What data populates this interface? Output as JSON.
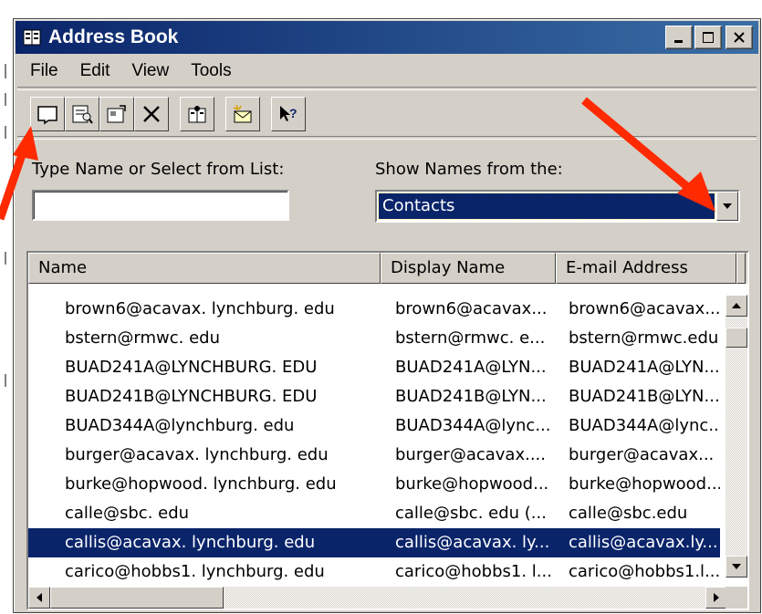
{
  "window": {
    "title": "Address Book"
  },
  "menu": [
    "File",
    "Edit",
    "View",
    "Tools"
  ],
  "toolbar": {
    "buttons": [
      "new-contact",
      "properties-card",
      "properties",
      "delete",
      "find",
      "new-message",
      "help"
    ]
  },
  "search": {
    "label": "Type Name or Select from List:",
    "value": ""
  },
  "source": {
    "label": "Show Names from the:",
    "selected": "Contacts"
  },
  "list": {
    "columns": [
      "Name",
      "Display Name",
      "E-mail Address"
    ],
    "rows": [
      {
        "name": "brown6@acavax. lynchburg. edu",
        "display": "brown6@acavax...",
        "email": "brown6@acavax..."
      },
      {
        "name": "bstern@rmwc. edu",
        "display": "bstern@rmwc. e...",
        "email": "bstern@rmwc.edu"
      },
      {
        "name": "BUAD241A@LYNCHBURG. EDU",
        "display": "BUAD241A@LYN...",
        "email": "BUAD241A@LYN..."
      },
      {
        "name": "BUAD241B@LYNCHBURG. EDU",
        "display": "BUAD241B@LYN...",
        "email": "BUAD241B@LYN..."
      },
      {
        "name": "BUAD344A@lynchburg. edu",
        "display": "BUAD344A@lync...",
        "email": "BUAD344A@lync..."
      },
      {
        "name": "burger@acavax. lynchburg. edu",
        "display": "burger@acavax....",
        "email": "burger@acavax..."
      },
      {
        "name": "burke@hopwood. lynchburg. edu",
        "display": "burke@hopwood...",
        "email": "burke@hopwood..."
      },
      {
        "name": "calle@sbc. edu",
        "display": "calle@sbc. edu (...",
        "email": "calle@sbc.edu"
      },
      {
        "name": "callis@acavax. lynchburg. edu",
        "display": "callis@acavax. ly...",
        "email": "callis@acavax.ly..."
      },
      {
        "name": "carico@hobbs1. lynchburg. edu",
        "display": "carico@hobbs1. l...",
        "email": "carico@hobbs1.l..."
      }
    ],
    "selected_index": 8
  },
  "colors": {
    "title_start": "#0a246a",
    "title_end": "#3a6ea5",
    "selection": "#0a246a",
    "annotation_arrow": "#ff2a00",
    "face": "#d4d0c8"
  }
}
